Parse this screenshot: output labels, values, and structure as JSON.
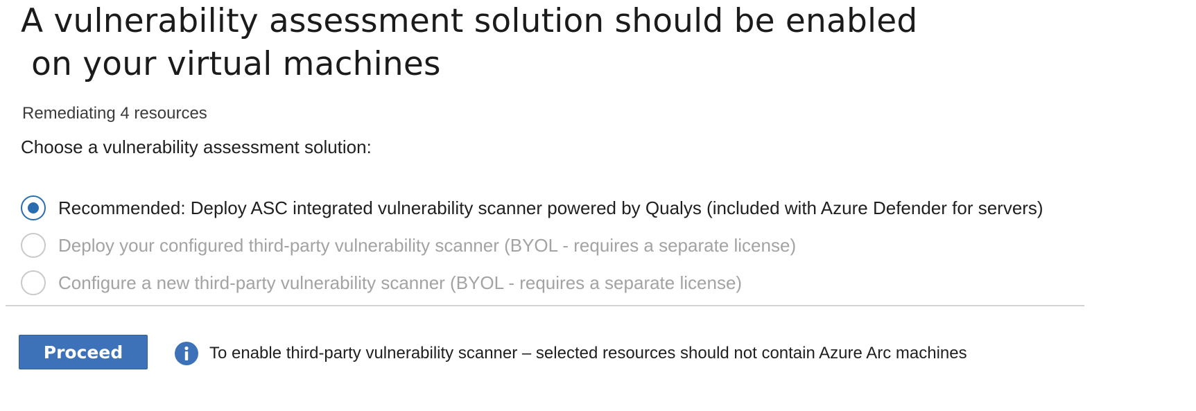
{
  "title": {
    "line1": "A vulnerability assessment solution should be enabled",
    "line2": " on your virtual machines"
  },
  "subtitle": "Remediating 4 resources",
  "prompt": "Choose a vulnerability assessment solution:",
  "options": [
    {
      "label": "Recommended: Deploy ASC integrated vulnerability scanner powered by Qualys (included with Azure Defender for servers)",
      "checked": true,
      "enabled": true
    },
    {
      "label": "Deploy your configured third-party vulnerability scanner (BYOL - requires a separate license)",
      "checked": false,
      "enabled": false
    },
    {
      "label": "Configure a new third-party vulnerability scanner (BYOL - requires a separate license)",
      "checked": false,
      "enabled": false
    }
  ],
  "footer": {
    "proceed_label": "Proceed",
    "info_icon": "info-icon",
    "info_text": "To enable third-party vulnerability scanner – selected resources should not contain Azure Arc machines"
  },
  "colors": {
    "accent": "#3d72b8",
    "disabled_text": "#a3a3a3",
    "divider": "#d2d2d2"
  }
}
